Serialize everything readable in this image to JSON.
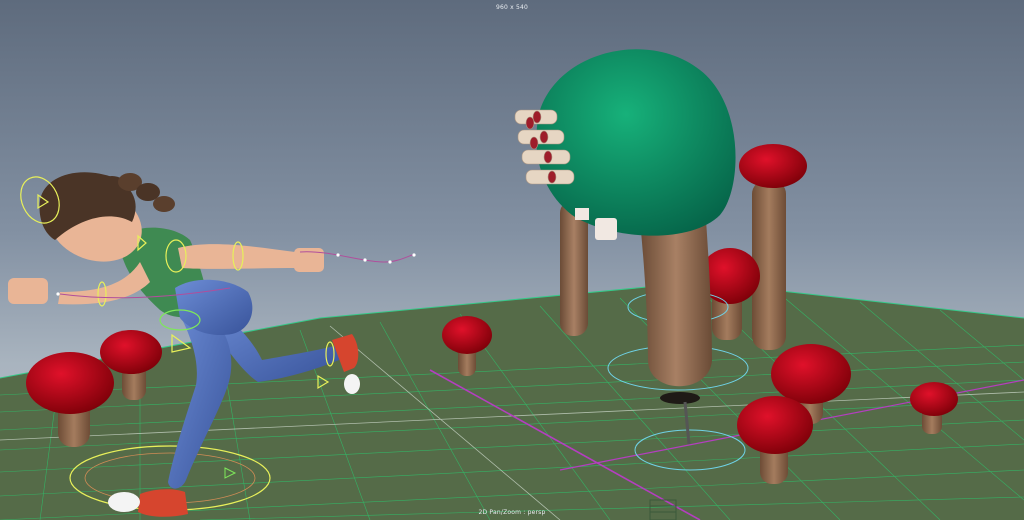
{
  "viewport": {
    "resolution_gate": "960 x 540",
    "hud_camera": "2D Pan/Zoom : persp"
  },
  "colors": {
    "sky_top": "#5e6b7d",
    "sky_bottom": "#b7c0c8",
    "ground": "#556b48",
    "grid_line": "#2fbf6a",
    "grid_major": "#c7d3c4",
    "axis_line": "#b43ec0",
    "mushroom_cap": "#b3000e",
    "mushroom_stem": "#8a6348",
    "tree_canopy": "#0c8f61",
    "character_shirt": "#3f8a52",
    "character_jeans": "#4f6fb8",
    "character_hair": "#4a3426",
    "character_skin": "#e9b596",
    "shoe": "#d6452e",
    "rig_control": "#e8f05a"
  },
  "scene": {
    "character": "running-girl-rig",
    "tree": "creature-tree",
    "mushroom_count": 10
  }
}
